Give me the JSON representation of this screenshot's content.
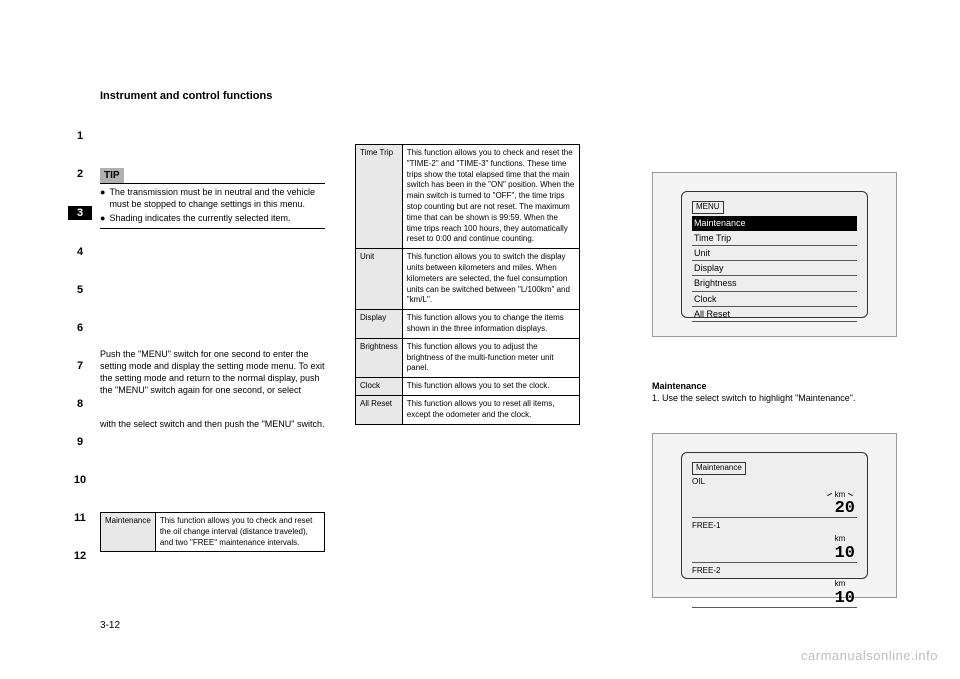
{
  "header": {
    "title": "Instrument and control functions"
  },
  "sidebar": [
    "1",
    "2",
    "3",
    "4",
    "5",
    "6",
    "7",
    "8",
    "9",
    "10",
    "11",
    "12"
  ],
  "sidebar_active_index": 2,
  "tip": {
    "label": "TIP",
    "lines": [
      "The transmission must be in neutral and the vehicle must be stopped to change settings in this menu.",
      "Shading indicates the currently selected item."
    ]
  },
  "desc": {
    "p1": "Push the \"MENU\" switch for one second to enter the setting mode and display the setting mode menu. To exit the setting mode and return to the normal display, push the \"MENU\" switch again for one second, or select",
    "p2": "with the select switch and then push the \"MENU\" switch."
  },
  "maintenance_label": "Maintenance",
  "settings_rows": [
    {
      "label": "Maintenance",
      "desc": "This function allows you to check and reset the oil change interval (distance traveled), and two \"FREE\" maintenance intervals."
    },
    {
      "label": "Time Trip",
      "desc": "This function allows you to check and reset the \"TIME-2\" and \"TIME-3\" functions. These time trips show the total elapsed time that the main switch has been in the \"ON\" position. When the main switch is turned to \"OFF\", the time trips stop counting but are not reset. The maximum time that can be shown is 99:59. When the time trips reach 100 hours, they automatically reset to 0:00 and continue counting."
    },
    {
      "label": "Unit",
      "desc": "This function allows you to switch the display units between kilometers and miles. When kilometers are selected, the fuel consumption units can be switched between \"L/100km\" and \"km/L\"."
    },
    {
      "label": "Display",
      "desc": "This function allows you to change the items shown in the three information displays."
    },
    {
      "label": "Brightness",
      "desc": "This function allows you to adjust the brightness of the multi-function meter unit panel."
    },
    {
      "label": "Clock",
      "desc": "This function allows you to set the clock."
    },
    {
      "label": "All Reset",
      "desc": "This function allows you to reset all items, except the odometer and the clock."
    }
  ],
  "lcd1": {
    "title": "MENU",
    "items": [
      "Maintenance",
      "Time Trip",
      "Unit",
      "Display",
      "Brightness",
      "Clock",
      "All Reset"
    ],
    "selected_index": 0
  },
  "maint_section": {
    "heading": "Maintenance",
    "p1": "1. Use the select switch to highlight \"Maintenance\"."
  },
  "lcd2": {
    "title": "Maintenance",
    "rows": [
      {
        "label": "OIL",
        "unit": "km",
        "value": "20",
        "flash": true
      },
      {
        "label": "FREE-1",
        "unit": "km",
        "value": "10",
        "flash": false
      },
      {
        "label": "FREE-2",
        "unit": "km",
        "value": "10",
        "flash": false
      }
    ]
  },
  "footer": {
    "page": "3-12",
    "source": "carmanualsonline.info"
  }
}
